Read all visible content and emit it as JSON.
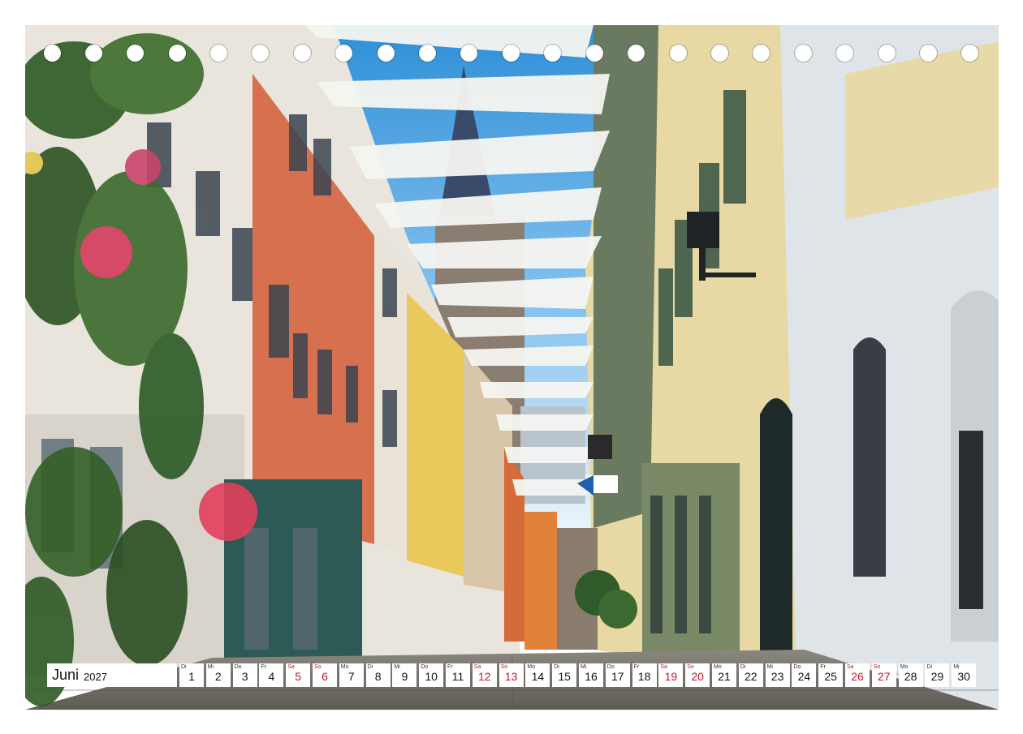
{
  "calendar": {
    "month": "Juni",
    "year": "2027",
    "weekend_color": "#c2182b",
    "days": [
      {
        "dow": "Di",
        "num": "1",
        "weekend": false
      },
      {
        "dow": "Mi",
        "num": "2",
        "weekend": false
      },
      {
        "dow": "Do",
        "num": "3",
        "weekend": false
      },
      {
        "dow": "Fr",
        "num": "4",
        "weekend": false
      },
      {
        "dow": "Sa",
        "num": "5",
        "weekend": true
      },
      {
        "dow": "So",
        "num": "6",
        "weekend": true
      },
      {
        "dow": "Mo",
        "num": "7",
        "weekend": false
      },
      {
        "dow": "Di",
        "num": "8",
        "weekend": false
      },
      {
        "dow": "Mi",
        "num": "9",
        "weekend": false
      },
      {
        "dow": "Do",
        "num": "10",
        "weekend": false
      },
      {
        "dow": "Fr",
        "num": "11",
        "weekend": false
      },
      {
        "dow": "Sa",
        "num": "12",
        "weekend": true
      },
      {
        "dow": "So",
        "num": "13",
        "weekend": true
      },
      {
        "dow": "Mo",
        "num": "14",
        "weekend": false
      },
      {
        "dow": "Di",
        "num": "15",
        "weekend": false
      },
      {
        "dow": "Mi",
        "num": "16",
        "weekend": false
      },
      {
        "dow": "Do",
        "num": "17",
        "weekend": false
      },
      {
        "dow": "Fr",
        "num": "18",
        "weekend": false
      },
      {
        "dow": "Sa",
        "num": "19",
        "weekend": true
      },
      {
        "dow": "So",
        "num": "20",
        "weekend": true
      },
      {
        "dow": "Mo",
        "num": "21",
        "weekend": false
      },
      {
        "dow": "Di",
        "num": "22",
        "weekend": false
      },
      {
        "dow": "Mi",
        "num": "23",
        "weekend": false
      },
      {
        "dow": "Do",
        "num": "24",
        "weekend": false
      },
      {
        "dow": "Fr",
        "num": "25",
        "weekend": false
      },
      {
        "dow": "Sa",
        "num": "26",
        "weekend": true
      },
      {
        "dow": "So",
        "num": "27",
        "weekend": true
      },
      {
        "dow": "Mo",
        "num": "28",
        "weekend": false
      },
      {
        "dow": "Di",
        "num": "29",
        "weekend": false
      },
      {
        "dow": "Mi",
        "num": "30",
        "weekend": false
      }
    ]
  }
}
